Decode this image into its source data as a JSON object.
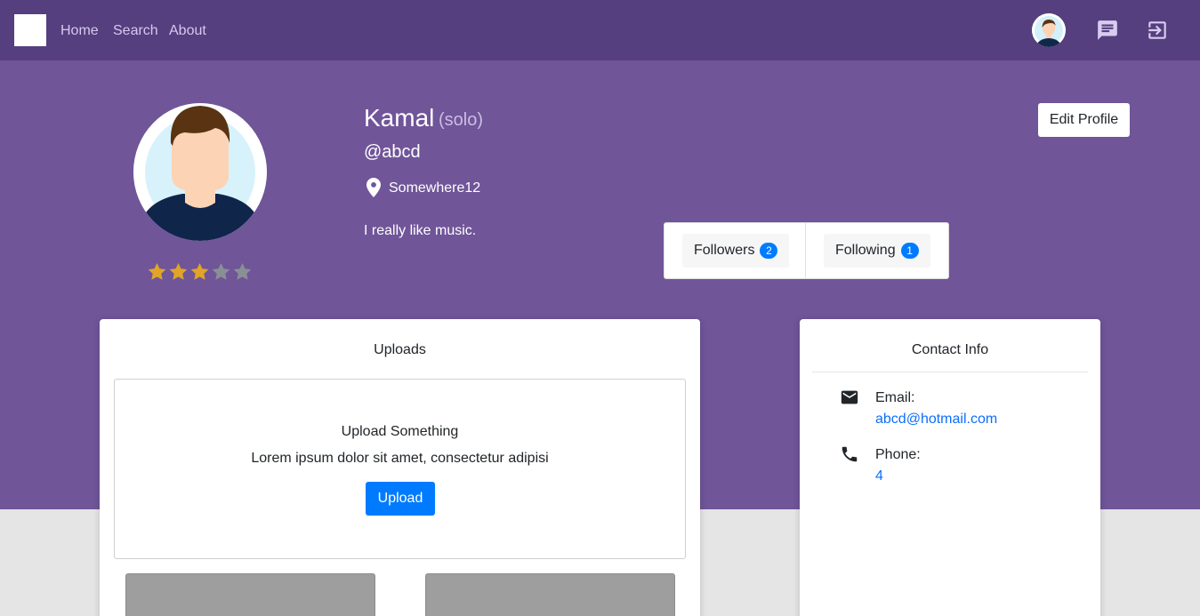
{
  "nav": {
    "links": [
      "Home",
      "Search",
      "About"
    ]
  },
  "profile": {
    "name": "Kamal",
    "type": "(solo)",
    "handle": "@abcd",
    "location": "Somewhere12",
    "bio": "I really like music.",
    "rating": 3,
    "rating_max": 5,
    "edit_label": "Edit Profile",
    "followers_label": "Followers",
    "followers_count": "2",
    "following_label": "Following",
    "following_count": "1"
  },
  "uploads": {
    "title": "Uploads",
    "box_title": "Upload Something",
    "box_desc": "Lorem ipsum dolor sit amet, consectetur adipisi",
    "button_label": "Upload"
  },
  "contact": {
    "title": "Contact Info",
    "email_label": "Email:",
    "email_value": "abcd@hotmail.com",
    "phone_label": "Phone:",
    "phone_value": "4"
  },
  "icons": {
    "messages": "chat-bubble-icon",
    "logout": "logout-icon",
    "location": "map-pin-icon",
    "email": "envelope-icon",
    "phone": "phone-icon"
  },
  "colors": {
    "navbar": "#553f7e",
    "hero": "#705599",
    "accent": "#007bff",
    "star_on": "#e0a526",
    "star_off": "#8a8f96"
  }
}
